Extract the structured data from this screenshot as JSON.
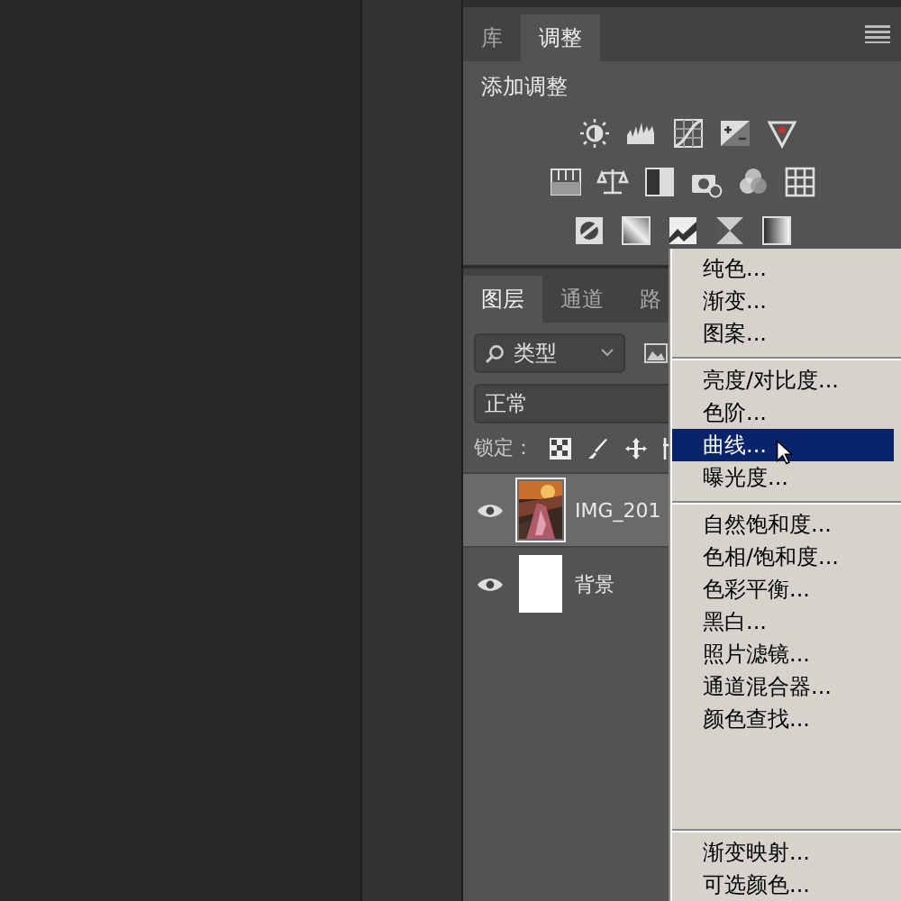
{
  "adjustments_panel": {
    "tabs": [
      {
        "label": "库",
        "selected": false
      },
      {
        "label": "调整",
        "selected": true
      }
    ],
    "heading": "添加调整"
  },
  "layers_panel": {
    "tabs": [
      {
        "label": "图层",
        "selected": true
      },
      {
        "label": "通道",
        "selected": false
      },
      {
        "label": "路",
        "selected": false
      }
    ],
    "filter": {
      "value": "类型"
    },
    "blend_mode": {
      "value": "正常"
    },
    "lock_label": "锁定：",
    "layers": [
      {
        "name": "IMG_201",
        "visible": true,
        "selected": true
      },
      {
        "name": "背景",
        "visible": true,
        "selected": false,
        "kind": "white"
      }
    ]
  },
  "context_menu": {
    "groups": [
      [
        {
          "label": "纯色...",
          "selected": false
        },
        {
          "label": "渐变...",
          "selected": false
        },
        {
          "label": "图案...",
          "selected": false
        }
      ],
      [
        {
          "label": "亮度/对比度...",
          "selected": false
        },
        {
          "label": "色阶...",
          "selected": false
        },
        {
          "label": "曲线...",
          "selected": true
        },
        {
          "label": "曝光度...",
          "selected": false
        }
      ],
      [
        {
          "label": "自然饱和度...",
          "selected": false
        },
        {
          "label": "色相/饱和度...",
          "selected": false
        },
        {
          "label": "色彩平衡...",
          "selected": false
        },
        {
          "label": "黑白...",
          "selected": false
        },
        {
          "label": "照片滤镜...",
          "selected": false
        },
        {
          "label": "通道混合器...",
          "selected": false
        },
        {
          "label": "颜色查找...",
          "selected": false
        }
      ],
      [
        {
          "label": "渐变映射...",
          "selected": false
        },
        {
          "label": "可选颜色...",
          "selected": false
        }
      ]
    ]
  }
}
